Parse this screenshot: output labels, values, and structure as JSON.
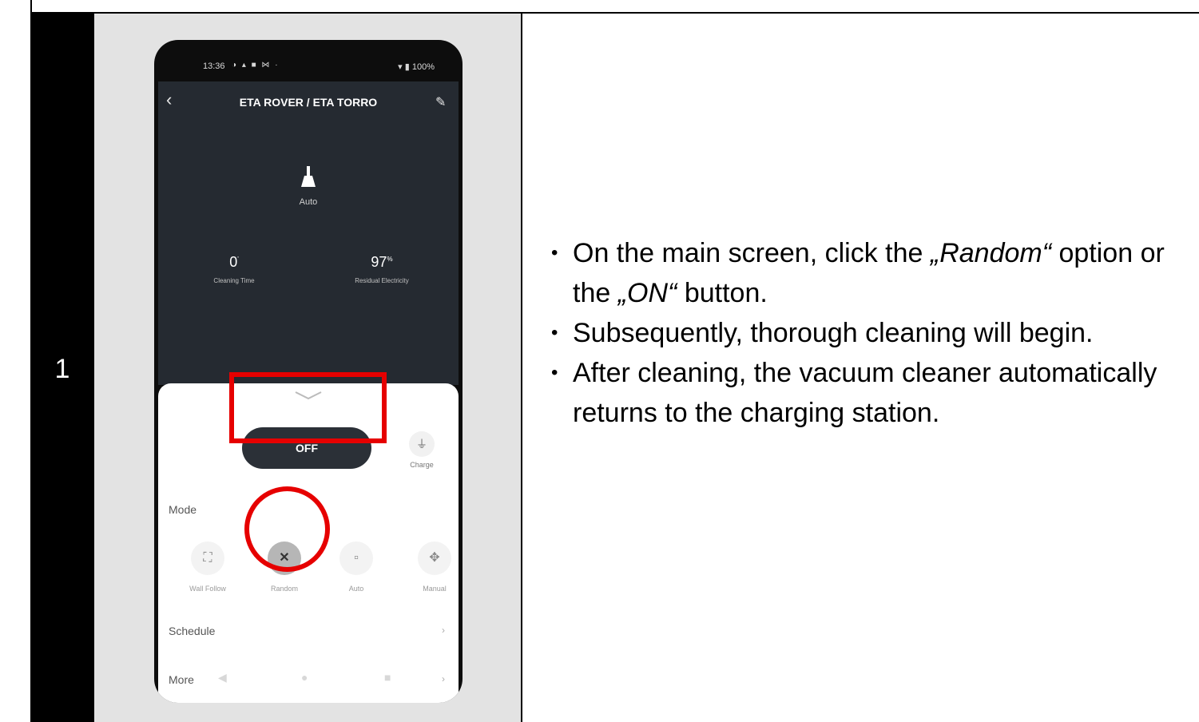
{
  "step": {
    "number": "1"
  },
  "phone": {
    "status_bar": {
      "time": "13:36",
      "left_icons": "◑ ▴ ■ ⋈ ·",
      "right": "▾ ▮ 100%"
    },
    "app_title": "ETA ROVER / ETA TORRO",
    "current_mode": "Auto",
    "stats": [
      {
        "value": "0",
        "unit": "'",
        "label": "Cleaning Time"
      },
      {
        "value": "97",
        "unit": "%",
        "label": "Residual Electricity"
      }
    ],
    "power_button": "OFF",
    "charge_label": "Charge",
    "mode_title": "Mode",
    "modes": [
      {
        "label": "Wall Follow",
        "icon": "frame-icon"
      },
      {
        "label": "Random",
        "icon": "random-icon"
      },
      {
        "label": "Auto",
        "icon": "square-icon"
      },
      {
        "label": "Manual",
        "icon": "move-icon"
      }
    ],
    "schedule_label": "Schedule",
    "more_label": "More"
  },
  "instructions": {
    "b1_pre": "On the main screen, click the ",
    "b1_random": "„Random“",
    "b1_mid": " option or the ",
    "b1_on": "„ON“",
    "b1_post": " button.",
    "b2": "Subsequently, thorough cleaning will begin.",
    "b3": "After cleaning, the vacuum cleaner automatically returns to the charging station."
  },
  "colors": {
    "highlight": "#e60000",
    "app_dark": "#252a31",
    "panel": "#e3e3e3"
  }
}
